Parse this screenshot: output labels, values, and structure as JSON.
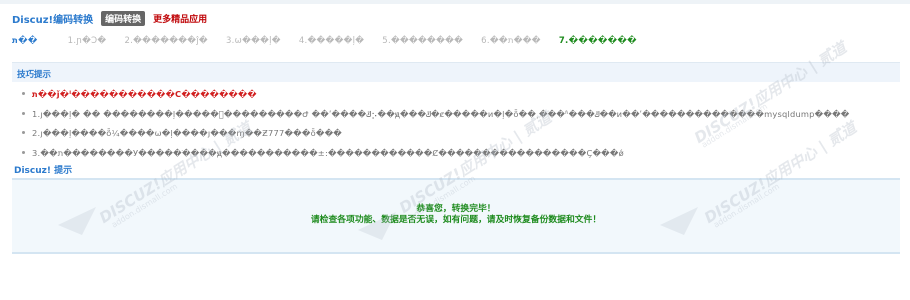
{
  "header": {
    "title": "Discuz!编码转换",
    "active_tab": "编码转换",
    "more_link": "更多精品应用"
  },
  "steps": [
    "ת��",
    "1.ɲ�Ͻ�",
    "2.�������ĵ�",
    "3.ѡ���ļ�",
    "4.�����ļ�",
    "5.��������",
    "6.��ת���",
    "7.�������"
  ],
  "tips": {
    "title": "技巧提示",
    "items": [
      "ת��ǰ�ˡ�����������С��������",
      "1.ȷ���ļ� �� ��������ļ�����ͬ���������Ժ ��ʹ����ݿ⡢��ԭ���ݿ�ȼ�����ͷ�ļ�ȫ��˲���ʱ���ݿ��ͷ��ʹ��������������mysqldump����",
      "2.ȷ���ļ����ȫ¼����ѡ�ļ����ȷ���ɱ��Ƶ777���ȫ���",
      "3.��ת��������У�����ֹ����ԭ�����������±:������������Ȼ�����������������Ҫ���ǿ"
    ]
  },
  "message": {
    "title": "Discuz! 提示",
    "line1": "恭喜您，转换完毕！",
    "line2": "请检查各项功能、数据是否无误，如有问题，请及时恢复备份数据和文件！"
  },
  "watermark": {
    "brand": "DISCUZ!应用中心 | 贰道",
    "site": "addon.dismall.com"
  },
  "colors": {
    "accent": "#2b7acd",
    "success": "#1e8b1e",
    "alert": "#c0080b"
  }
}
